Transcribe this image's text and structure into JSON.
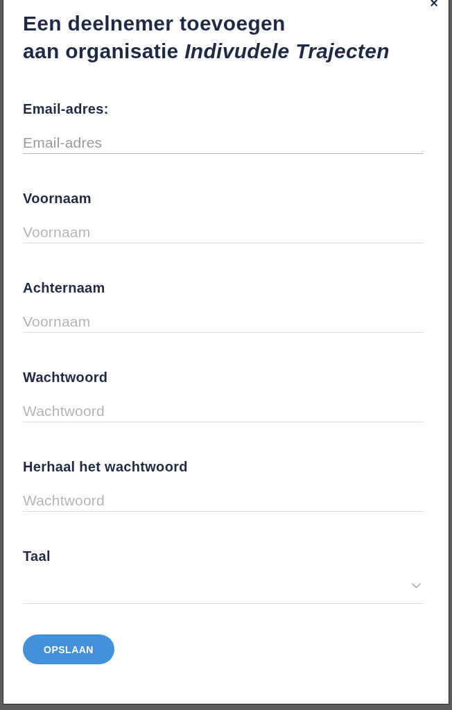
{
  "dialog": {
    "title": "Een deelnemer toevoegen\naan organisatie *Indivudele Trajecten*",
    "close_button": {
      "label": "×"
    }
  },
  "fields": [
    {
      "kind": "text",
      "label": "Email-adres:",
      "placeholder": "Email-adres",
      "focused": true
    },
    {
      "kind": "text",
      "label": "Voornaam",
      "placeholder": "Voornaam",
      "focused": false
    },
    {
      "kind": "text",
      "label": "Achternaam",
      "placeholder": "Voornaam",
      "focused": false
    },
    {
      "kind": "text",
      "label": "Wachtwoord",
      "placeholder": "Wachtwoord",
      "focused": false
    },
    {
      "kind": "text",
      "label": "Herhaal het wachtwoord",
      "placeholder": "Wachtwoord",
      "focused": false
    },
    {
      "kind": "select",
      "label": "Taal",
      "focused": false
    }
  ],
  "submit_button": {
    "label": "OPSLAAN"
  }
}
